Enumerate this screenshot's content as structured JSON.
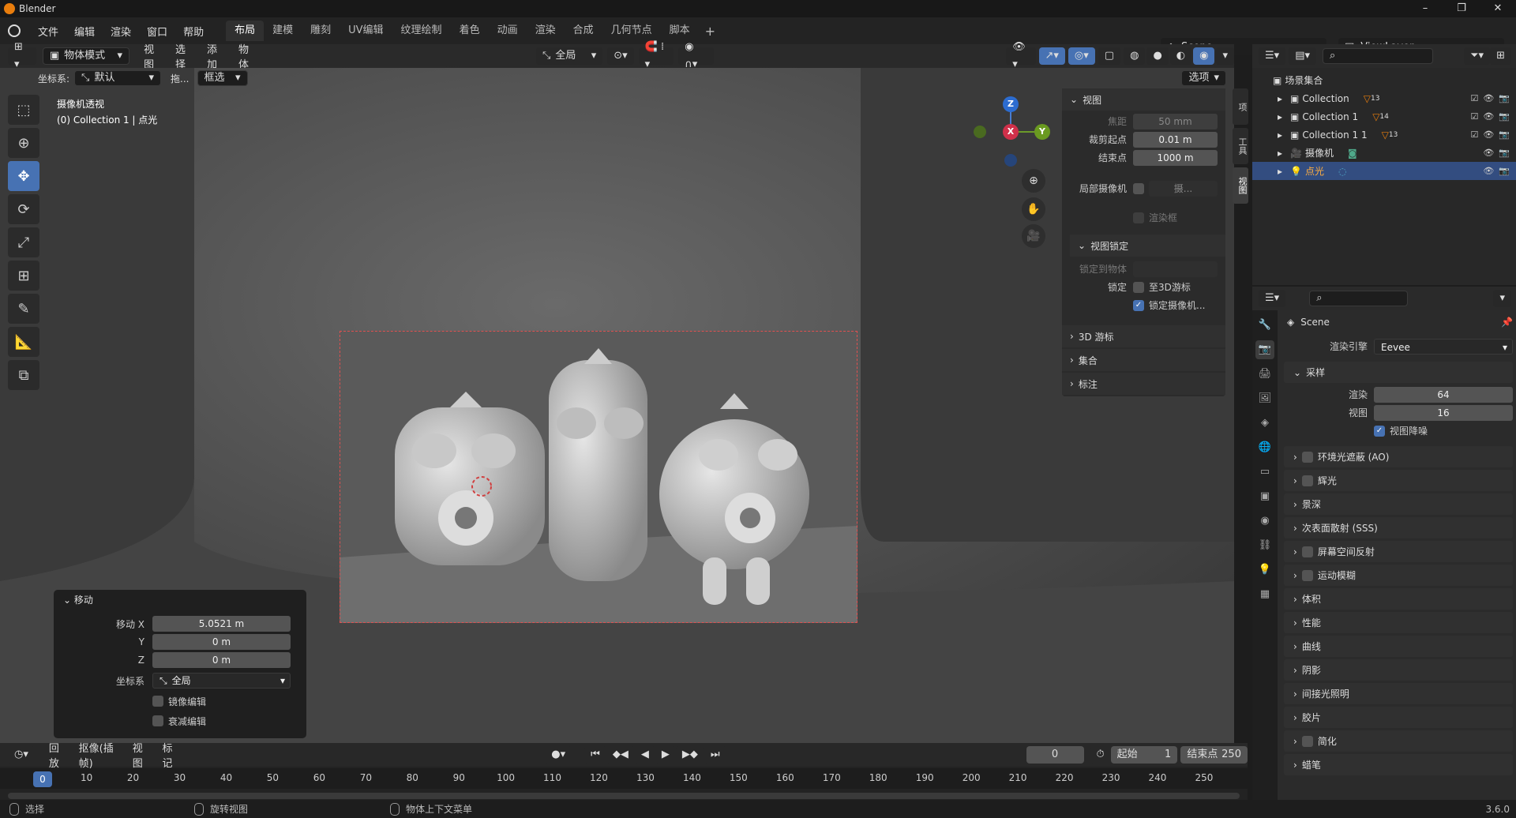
{
  "window": {
    "title": "Blender",
    "version": "3.6.0"
  },
  "menu": [
    "文件",
    "编辑",
    "渲染",
    "窗口",
    "帮助"
  ],
  "workspaces": [
    {
      "label": "布局",
      "active": true
    },
    {
      "label": "建模"
    },
    {
      "label": "雕刻"
    },
    {
      "label": "UV编辑"
    },
    {
      "label": "纹理绘制"
    },
    {
      "label": "着色"
    },
    {
      "label": "动画"
    },
    {
      "label": "渲染"
    },
    {
      "label": "合成"
    },
    {
      "label": "几何节点"
    },
    {
      "label": "脚本"
    }
  ],
  "scene": {
    "name": "Scene",
    "view_layer": "ViewLayer"
  },
  "viewport_header": {
    "mode": "物体模式",
    "menus": [
      "视图",
      "选择",
      "添加",
      "物体"
    ],
    "transform": "全局",
    "options": "选项"
  },
  "viewport_sub": {
    "coord_label": "坐标系:",
    "coord_value": "默认",
    "drag_label": "拖...",
    "select_mode": "框选"
  },
  "viewport_info": {
    "line1": "摄像机透视",
    "line2": "(0) Collection 1 | 点光"
  },
  "npanel": {
    "view_title": "视图",
    "focal_label": "焦距",
    "focal_value": "50 mm",
    "clip_start_label": "裁剪起点",
    "clip_start_value": "0.01 m",
    "clip_end_label": "结束点",
    "clip_end_value": "1000 m",
    "local_camera_label": "局部摄像机",
    "local_camera_value": "摄...",
    "render_region": "渲染框",
    "view_lock_title": "视图锁定",
    "lock_obj_label": "锁定到物体",
    "lock_label": "锁定",
    "lock_3d_cursor": "至3D游标",
    "lock_camera": "锁定摄像机...",
    "sec_cursor": "3D 游标",
    "sec_collection": "集合",
    "sec_annotation": "标注",
    "tabs": [
      "项",
      "工具",
      "视图"
    ]
  },
  "operator_panel": {
    "title": "移动",
    "move_x_label": "移动 X",
    "move_x": "5.0521 m",
    "y_label": "Y",
    "y": "0 m",
    "z_label": "Z",
    "z": "0 m",
    "orient_label": "坐标系",
    "orient": "全局",
    "mirror": "镜像编辑",
    "falloff": "衰减编辑"
  },
  "gizmo": {
    "x": "X",
    "y": "Y",
    "z": "Z"
  },
  "outliner": {
    "root": "场景集合",
    "items": [
      {
        "name": "Collection",
        "badge": "13"
      },
      {
        "name": "Collection 1",
        "badge": "14"
      },
      {
        "name": "Collection 1 1",
        "badge": "13"
      },
      {
        "name": "摄像机",
        "badge": ""
      },
      {
        "name": "点光",
        "badge": "",
        "selected": true
      }
    ]
  },
  "properties": {
    "scene_name": "Scene",
    "engine_label": "渲染引擎",
    "engine": "Eevee",
    "sampling": "采样",
    "render_label": "渲染",
    "render_value": "64",
    "viewport_label": "视图",
    "viewport_value": "16",
    "denoise": "视图降噪",
    "sections": [
      "环境光遮蔽 (AO)",
      "辉光",
      "景深",
      "次表面散射 (SSS)",
      "屏幕空间反射",
      "运动模糊",
      "体积",
      "性能",
      "曲线",
      "阴影",
      "间接光照明",
      "胶片",
      "简化",
      "蜡笔"
    ]
  },
  "timeline": {
    "menus": [
      "回放",
      "抠像(插帧)",
      "视图",
      "标记"
    ],
    "current": "0",
    "start_label": "起始",
    "start": "1",
    "end_label": "结束点",
    "end": "250",
    "frame_numbers": [
      "0",
      "10",
      "20",
      "30",
      "40",
      "50",
      "60",
      "70",
      "80",
      "90",
      "100",
      "110",
      "120",
      "130",
      "140",
      "150",
      "160",
      "170",
      "180",
      "190",
      "200",
      "210",
      "220",
      "230",
      "240",
      "250"
    ]
  },
  "status": {
    "select": "选择",
    "rotate": "旋转视图",
    "context": "物体上下文菜单"
  }
}
